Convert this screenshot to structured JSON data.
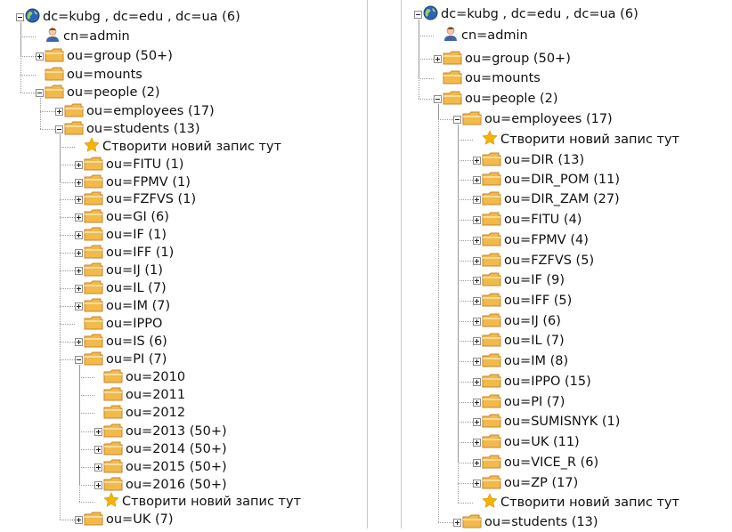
{
  "left_tree": {
    "root": "dc=kubg , dc=edu , dc=ua (6)",
    "admin": "cn=admin",
    "group": "ou=group (50+)",
    "mounts": "ou=mounts",
    "people": "ou=people (2)",
    "employees": "ou=employees (17)",
    "students": "ou=students (13)",
    "create_new_1": "Створити новий запис тут",
    "fitu": "ou=FITU (1)",
    "fpmv": "ou=FPMV (1)",
    "fzfvs": "ou=FZFVS (1)",
    "gi": "ou=GI (6)",
    "if": "ou=IF (1)",
    "iff": "ou=IFF (1)",
    "ij": "ou=IJ (1)",
    "il": "ou=IL (7)",
    "im": "ou=IM (7)",
    "ippo": "ou=IPPO",
    "is": "ou=IS (6)",
    "pi": "ou=PI (7)",
    "y2010": "ou=2010",
    "y2011": "ou=2011",
    "y2012": "ou=2012",
    "y2013": "ou=2013 (50+)",
    "y2014": "ou=2014 (50+)",
    "y2015": "ou=2015 (50+)",
    "y2016": "ou=2016 (50+)",
    "create_new_2": "Створити новий запис тут",
    "uk": "ou=UK (7)"
  },
  "right_tree": {
    "root": "dc=kubg , dc=edu , dc=ua (6)",
    "admin": "cn=admin",
    "group": "ou=group (50+)",
    "mounts": "ou=mounts",
    "people": "ou=people (2)",
    "employees": "ou=employees (17)",
    "create_new_1": "Створити новий запис тут",
    "dir": "ou=DIR (13)",
    "dir_pom": "ou=DIR_POM (11)",
    "dir_zam": "ou=DIR_ZAM (27)",
    "fitu": "ou=FITU (4)",
    "fpmv": "ou=FPMV (4)",
    "fzfvs": "ou=FZFVS (5)",
    "if": "ou=IF (9)",
    "iff": "ou=IFF (5)",
    "ij": "ou=IJ (6)",
    "il": "ou=IL (7)",
    "im": "ou=IM (8)",
    "ippo": "ou=IPPO (15)",
    "pi": "ou=PI (7)",
    "sumisnyk": "ou=SUMISNYK (1)",
    "uk": "ou=UK (11)",
    "vice_r": "ou=VICE_R (6)",
    "zp": "ou=ZP (17)",
    "create_new_2": "Створити новий запис тут",
    "students": "ou=students (13)"
  },
  "icons": {
    "root": "globe-icon",
    "admin": "user-icon",
    "folder": "folder-icon",
    "create": "star-icon"
  },
  "colors": {
    "folder": "#f2b94b",
    "folder_edge": "#c7862b",
    "globe": "#2d63b5",
    "star": "#f5b400",
    "tree_line": "#9a9a9a"
  }
}
